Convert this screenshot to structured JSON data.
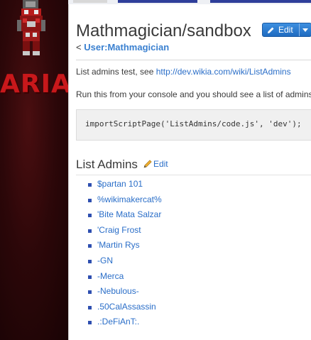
{
  "theme": {
    "background": "#2a0608",
    "accent": "#c8181b",
    "link": "#2a6ec8"
  },
  "wiki_logo": {
    "text": "ARIA"
  },
  "page": {
    "title": "Mathmagician/sandbox",
    "edit_button": {
      "label": "Edit",
      "icon": "pencil-icon",
      "dropdown_icon": "caret-down-icon"
    },
    "back_prefix": "<",
    "back_link": "User:Mathmagician"
  },
  "content": {
    "intro_text": "List admins test, see",
    "intro_link": "http://dev.wikia.com/wiki/ListAdmins",
    "instruction": "Run this from your console and you should see a list of admins",
    "code": "importScriptPage('ListAdmins/code.js', 'dev');"
  },
  "section": {
    "heading": "List Admins",
    "edit_label": "Edit",
    "edit_icon": "pencil-icon"
  },
  "admins": [
    "$partan 101",
    "%wikimakercat%",
    "'Bite Mata Salzar",
    "'Craig Frost",
    "'Martin Rys",
    "-GN",
    "-Merca",
    "-Nebulous-",
    ".50CalAssassin",
    ".:DeFiAnT:."
  ]
}
